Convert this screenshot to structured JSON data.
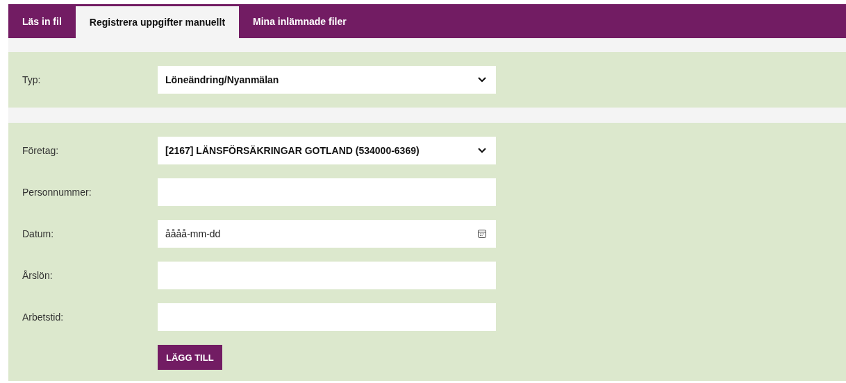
{
  "tabs": [
    {
      "label": "Läs in fil",
      "selected": false
    },
    {
      "label": "Registrera uppgifter manuellt",
      "selected": true
    },
    {
      "label": "Mina inlämnade filer",
      "selected": false
    }
  ],
  "type_section": {
    "label": "Typ:",
    "value": "Löneändring/Nyanmälan"
  },
  "form": {
    "fields": [
      {
        "kind": "select",
        "label": "Företag:",
        "value": "[2167] LÄNSFÖRSÄKRINGAR GOTLAND (534000-6369)"
      },
      {
        "kind": "text",
        "label": "Personnummer:"
      },
      {
        "kind": "date",
        "label": "Datum:",
        "placeholder": "åååå-mm-dd"
      },
      {
        "kind": "text",
        "label": "Årslön:"
      },
      {
        "kind": "text",
        "label": "Arbetstid:"
      }
    ],
    "submit_button": "LÄGG TILL"
  }
}
